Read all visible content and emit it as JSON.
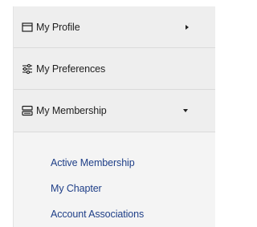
{
  "menu": {
    "items": [
      {
        "label": "My Profile",
        "icon": "profile-card-icon",
        "caret": "right"
      },
      {
        "label": "My Preferences",
        "icon": "sliders-icon",
        "caret": "none"
      },
      {
        "label": "My Membership",
        "icon": "membership-stack-icon",
        "caret": "down"
      }
    ],
    "submenu": [
      {
        "label": "Active Membership"
      },
      {
        "label": "My Chapter"
      },
      {
        "label": "Account Associations"
      }
    ]
  },
  "colors": {
    "panel_bg": "#f4f4f4",
    "item_bg": "#eeeeee",
    "divider": "#dadada",
    "text": "#1f1f1f",
    "link": "#1f3f88"
  }
}
